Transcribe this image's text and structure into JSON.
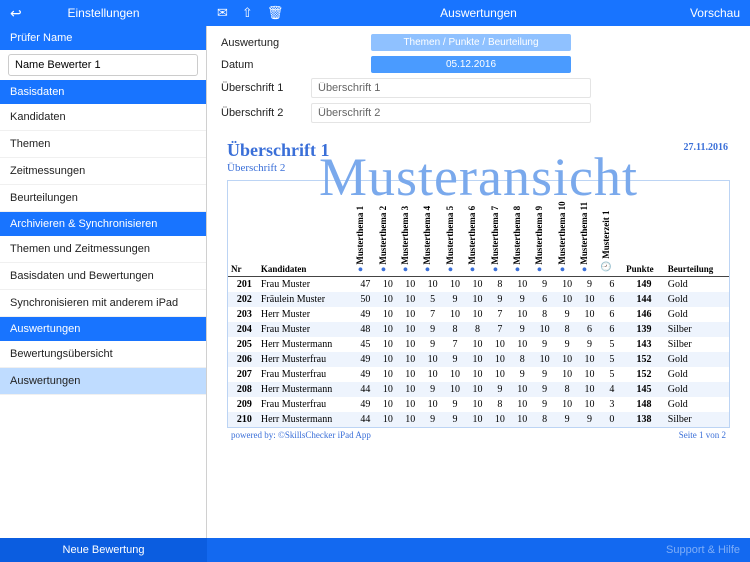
{
  "topbar": {
    "left_title": "Einstellungen",
    "right_title": "Auswertungen",
    "preview": "Vorschau"
  },
  "sidebar": {
    "prufer_head": "Prüfer Name",
    "prufer_value": "Name Bewerter 1",
    "sections": [
      {
        "head": "Basisdaten",
        "items": [
          "Kandidaten",
          "Themen",
          "Zeitmessungen",
          "Beurteilungen"
        ]
      },
      {
        "head": "Archivieren & Synchronisieren",
        "items": [
          "Themen und Zeitmessungen",
          "Basisdaten und Bewertungen",
          "Synchronisieren mit anderem iPad"
        ]
      },
      {
        "head": "Auswertungen",
        "items": [
          "Bewertungsübersicht",
          "Auswertungen"
        ]
      }
    ],
    "selected": "Auswertungen"
  },
  "form": {
    "rows": [
      {
        "label": "Auswertung",
        "pill": "Themen / Punkte / Beurteilung",
        "pillClass": "pill"
      },
      {
        "label": "Datum",
        "pill": "05.12.2016",
        "pillClass": "pill dk"
      },
      {
        "label": "Überschrift 1",
        "input": "Überschrift 1"
      },
      {
        "label": "Überschrift 2",
        "input": "Überschrift 2"
      }
    ]
  },
  "doc": {
    "h1": "Überschrift 1",
    "h2": "Überschrift 2",
    "date": "27.11.2016",
    "watermark": "Musteransicht",
    "powered": "powered by: ©SkillsChecker iPad App",
    "page": "Seite 1 von 2"
  },
  "chart_data": {
    "type": "table",
    "columns_fixed": [
      "Nr",
      "Kandidaten"
    ],
    "columns_themes": [
      "Musterthema 1",
      "Musterthema 2",
      "Musterthema 3",
      "Musterthema 4",
      "Musterthema 5",
      "Musterthema 6",
      "Musterthema 7",
      "Musterthema 8",
      "Musterthema 9",
      "Musterthema 10",
      "Musterthema 11"
    ],
    "columns_time": [
      "Musterzeit 1"
    ],
    "columns_tail": [
      "Punkte",
      "Beurteilung"
    ],
    "rows": [
      {
        "nr": 201,
        "name": "Frau Muster",
        "v": [
          47,
          10,
          10,
          10,
          10,
          10,
          8,
          10,
          9,
          10,
          9
        ],
        "t": [
          6
        ],
        "pk": 149,
        "b": "Gold"
      },
      {
        "nr": 202,
        "name": "Fräulein Muster",
        "v": [
          50,
          10,
          10,
          5,
          9,
          10,
          9,
          9,
          6,
          10,
          10
        ],
        "t": [
          6
        ],
        "pk": 144,
        "b": "Gold"
      },
      {
        "nr": 203,
        "name": "Herr Muster",
        "v": [
          49,
          10,
          10,
          7,
          10,
          10,
          7,
          10,
          8,
          9,
          10
        ],
        "t": [
          6
        ],
        "pk": 146,
        "b": "Gold"
      },
      {
        "nr": 204,
        "name": "Frau Muster",
        "v": [
          48,
          10,
          10,
          9,
          8,
          8,
          7,
          9,
          10,
          8,
          6
        ],
        "t": [
          6
        ],
        "pk": 139,
        "b": "Silber"
      },
      {
        "nr": 205,
        "name": "Herr Mustermann",
        "v": [
          45,
          10,
          10,
          9,
          7,
          10,
          10,
          10,
          9,
          9,
          9
        ],
        "t": [
          5
        ],
        "pk": 143,
        "b": "Silber"
      },
      {
        "nr": 206,
        "name": "Herr Musterfrau",
        "v": [
          49,
          10,
          10,
          10,
          9,
          10,
          10,
          8,
          10,
          10,
          10
        ],
        "t": [
          5
        ],
        "pk": 152,
        "b": "Gold"
      },
      {
        "nr": 207,
        "name": "Frau Musterfrau",
        "v": [
          49,
          10,
          10,
          10,
          10,
          10,
          10,
          9,
          9,
          10,
          10
        ],
        "t": [
          5
        ],
        "pk": 152,
        "b": "Gold"
      },
      {
        "nr": 208,
        "name": "Herr Mustermann",
        "v": [
          44,
          10,
          10,
          9,
          10,
          10,
          9,
          10,
          9,
          8,
          10
        ],
        "t": [
          4
        ],
        "pk": 145,
        "b": "Gold"
      },
      {
        "nr": 209,
        "name": "Frau Musterfrau",
        "v": [
          49,
          10,
          10,
          10,
          9,
          10,
          8,
          10,
          9,
          10,
          10
        ],
        "t": [
          3
        ],
        "pk": 148,
        "b": "Gold"
      },
      {
        "nr": 210,
        "name": "Herr Mustermann",
        "v": [
          44,
          10,
          10,
          9,
          9,
          10,
          10,
          10,
          8,
          9,
          9
        ],
        "t": [
          0
        ],
        "pk": 138,
        "b": "Silber"
      }
    ]
  },
  "bottom": {
    "left": "Neue Bewertung",
    "right": "Support & Hilfe"
  }
}
